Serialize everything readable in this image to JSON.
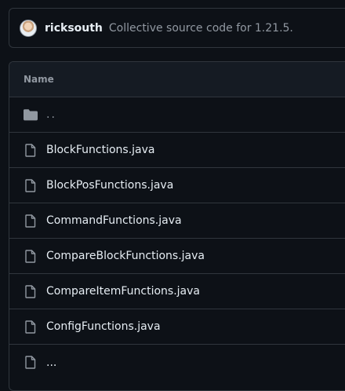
{
  "commit": {
    "author": "ricksouth",
    "message": "Collective source code for 1.21.5.",
    "avatar_icon": "user-avatar"
  },
  "table": {
    "header": "Name",
    "rows": [
      {
        "name": "..",
        "icon": "folder-icon",
        "kind": "parent"
      },
      {
        "name": "BlockFunctions.java",
        "icon": "file-icon",
        "kind": "file"
      },
      {
        "name": "BlockPosFunctions.java",
        "icon": "file-icon",
        "kind": "file"
      },
      {
        "name": "CommandFunctions.java",
        "icon": "file-icon",
        "kind": "file"
      },
      {
        "name": "CompareBlockFunctions.java",
        "icon": "file-icon",
        "kind": "file"
      },
      {
        "name": "CompareItemFunctions.java",
        "icon": "file-icon",
        "kind": "file"
      },
      {
        "name": "ConfigFunctions.java",
        "icon": "file-icon",
        "kind": "file"
      },
      {
        "name": "...",
        "icon": "file-icon",
        "kind": "file"
      }
    ]
  },
  "colors": {
    "background": "#0d1117",
    "border": "#30363d",
    "text": "#e6edf3",
    "muted": "#9198a1"
  }
}
